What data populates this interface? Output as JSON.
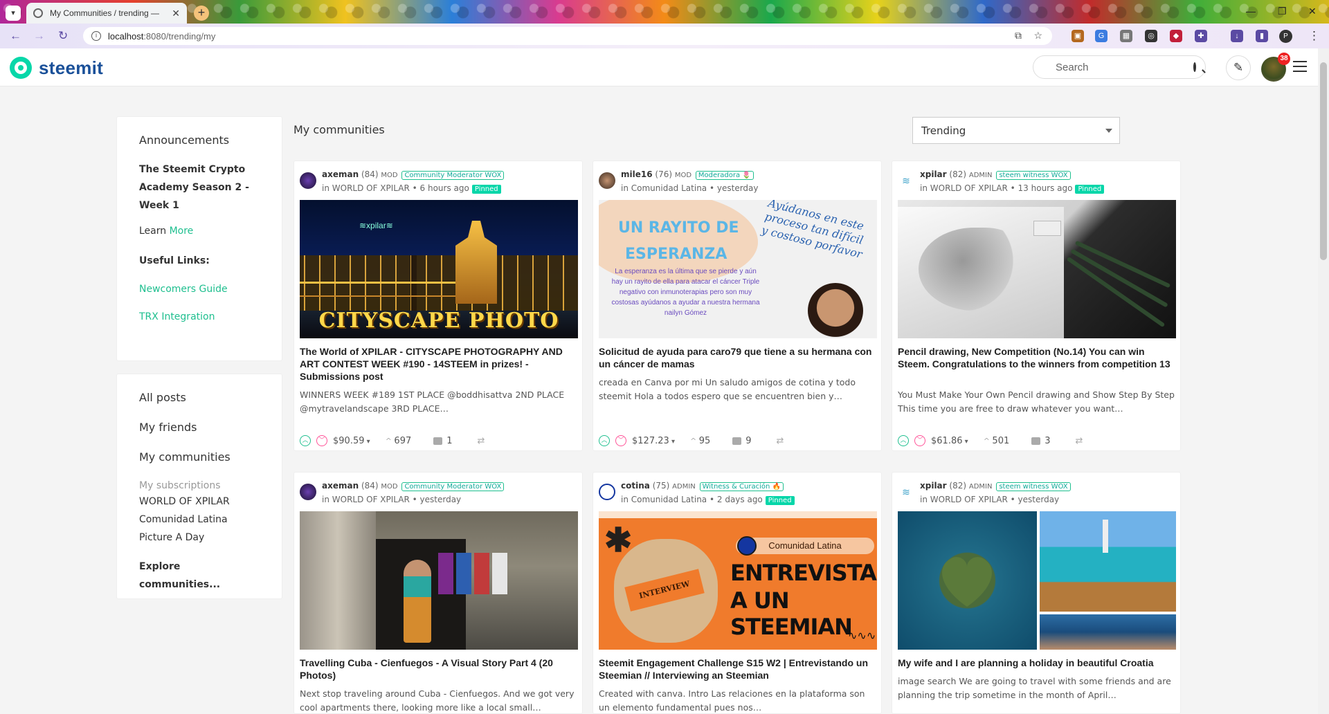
{
  "browser": {
    "tab_title": "My Communities / trending —",
    "url_host": "localhost",
    "url_path": ":8080/trending/my",
    "profile_initial": "P"
  },
  "header": {
    "logo_text": "steemit",
    "search_placeholder": "Search",
    "notifications": "38"
  },
  "sidebar": {
    "announcements_title": "Announcements",
    "announcement": "The Steemit Crypto Academy Season 2 - Week 1",
    "learn_prefix": "Learn ",
    "learn_link": "More",
    "useful_links_title": "Useful Links:",
    "links": [
      "Newcomers Guide",
      "TRX Integration"
    ],
    "nav": [
      "All posts",
      "My friends",
      "My communities"
    ],
    "subscriptions_label": "My subscriptions",
    "subscriptions": [
      "WORLD OF XPILAR",
      "Comunidad Latina",
      "Picture A Day"
    ],
    "explore": "Explore communities..."
  },
  "main": {
    "title": "My communities",
    "sort_value": "Trending"
  },
  "posts": [
    {
      "author": "axeman",
      "rep": "(84)",
      "role": "MOD",
      "badge": "Community Moderator WOX",
      "community": "in WORLD OF XPILAR",
      "time": "• 6 hours ago",
      "pinned": "Pinned",
      "title": "The World of XPILAR - CITYSCAPE PHOTOGRAPHY AND ART CONTEST WEEK #190 - 14STEEM in prizes! - Submissions post",
      "excerpt": "WINNERS WEEK #189 1ST PLACE @boddhisattva 2ND PLACE @mytravelandscape 3RD PLACE…",
      "payout": "$90.59",
      "votes": "697",
      "comments": "1",
      "image_caption": "CITYSCAPE PHOTO"
    },
    {
      "author": "mile16",
      "rep": "(76)",
      "role": "MOD",
      "badge": "Moderadora 🌷",
      "community": "in Comunidad Latina",
      "time": "• yesterday",
      "pinned": "",
      "title": "Solicitud de ayuda para caro79 que tiene a su hermana con un cáncer de mamas",
      "excerpt": "creada en Canva por mi Un saludo amigos de cotina y todo steemit Hola a todos espero que se encuentren bien y…",
      "payout": "$127.23",
      "votes": "95",
      "comments": "9",
      "image_h1": "UN RAYITO DE",
      "image_h2": "ESPERANZA",
      "image_side": "Ayúdanos en este proceso tan difícil y costoso porfavor",
      "image_body": "La esperanza es la última que se pierde y aún hay un rayito de ella para atacar el cáncer Triple negativo con inmunoterapias pero son muy costosas ayúdanos a ayudar a nuestra hermana nailyn Gómez"
    },
    {
      "author": "xpilar",
      "rep": "(82)",
      "role": "ADMIN",
      "badge": "steem witness WOX",
      "community": "in WORLD OF XPILAR",
      "time": "• 13 hours ago",
      "pinned": "Pinned",
      "title": "Pencil drawing, New Competition (No.14) You can win Steem. Congratulations to the winners from competition 13",
      "excerpt": "You Must Make Your Own Pencil drawing and Show Step By Step This time you are free to draw whatever you want…",
      "payout": "$61.86",
      "votes": "501",
      "comments": "3"
    },
    {
      "author": "axeman",
      "rep": "(84)",
      "role": "MOD",
      "badge": "Community Moderator WOX",
      "community": "in WORLD OF XPILAR",
      "time": "• yesterday",
      "pinned": "",
      "title": "Travelling Cuba - Cienfuegos - A Visual Story Part 4 (20 Photos)",
      "excerpt": "Next stop traveling around Cuba - Cienfuegos. And we got very cool apartments there, looking more like a local small…",
      "payout": "",
      "votes": "",
      "comments": ""
    },
    {
      "author": "cotina",
      "rep": "(75)",
      "role": "ADMIN",
      "badge": "Witness & Curación 🔥",
      "community": "in Comunidad Latina",
      "time": "• 2 days ago",
      "pinned": "Pinned",
      "title": "Steemit Engagement Challenge S15 W2 | Entrevistando un Steemian // Interviewing an Steemian",
      "excerpt": "Created with canva. Intro Las relaciones en la plataforma son un elemento fundamental pues nos…",
      "payout": "",
      "votes": "",
      "comments": "",
      "image_pill": "Comunidad Latina",
      "image_big1": "ENTREVISTANDO",
      "image_big2": "A UN STEEMIAN",
      "image_tag": "INTERVIEW"
    },
    {
      "author": "xpilar",
      "rep": "(82)",
      "role": "ADMIN",
      "badge": "steem witness WOX",
      "community": "in WORLD OF XPILAR",
      "time": "• yesterday",
      "pinned": "",
      "title": "My wife and I are planning a holiday in beautiful Croatia",
      "excerpt": "image search We are going to travel with some friends and are planning the trip sometime in the month of April…",
      "payout": "",
      "votes": "",
      "comments": ""
    }
  ],
  "colors": {
    "accent": "#07d7a9",
    "brand": "#1a5099",
    "link": "#1fbf8f"
  }
}
